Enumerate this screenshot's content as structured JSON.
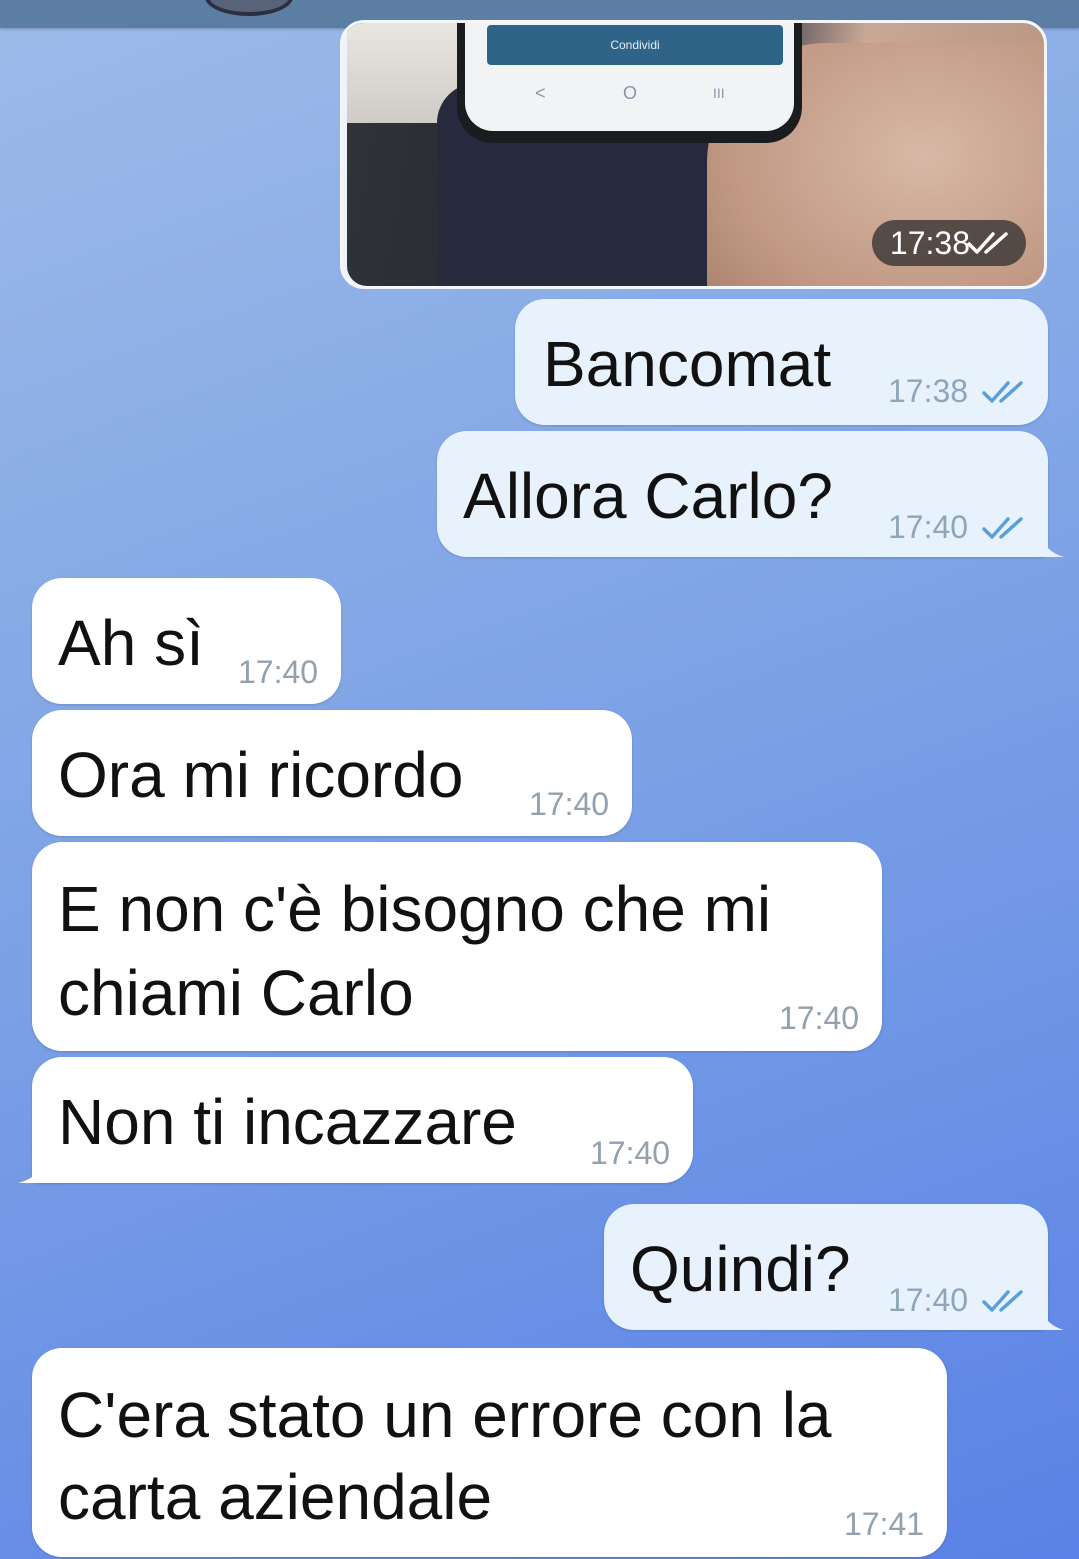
{
  "header": {},
  "photo_message": {
    "button_label": "Condividi",
    "nav_back": "<",
    "nav_home": "O",
    "nav_recent": "III",
    "time": "17:38"
  },
  "messages": [
    {
      "direction": "outgoing",
      "text": "Bancomat",
      "time": "17:38",
      "status": "read"
    },
    {
      "direction": "outgoing",
      "text": "Allora Carlo?",
      "time": "17:40",
      "status": "read"
    },
    {
      "direction": "incoming",
      "text": "Ah sì",
      "time": "17:40"
    },
    {
      "direction": "incoming",
      "text": "Ora mi ricordo",
      "time": "17:40"
    },
    {
      "direction": "incoming",
      "lines": [
        "E non c'è bisogno che mi",
        "chiami Carlo"
      ],
      "time": "17:40"
    },
    {
      "direction": "incoming",
      "text": "Non ti incazzare",
      "time": "17:40"
    },
    {
      "direction": "outgoing",
      "text": "Quindi?",
      "time": "17:40",
      "status": "read"
    },
    {
      "direction": "incoming",
      "lines": [
        "C'era stato un errore con la",
        "carta aziendale"
      ],
      "time": "17:41"
    }
  ],
  "colors": {
    "outgoing_bubble": "#e8f2fd",
    "incoming_bubble": "#ffffff",
    "read_tick": "#5aa0d8",
    "topbar": "#5d7ea3"
  },
  "icons": {
    "read_status": "double-check-icon"
  }
}
